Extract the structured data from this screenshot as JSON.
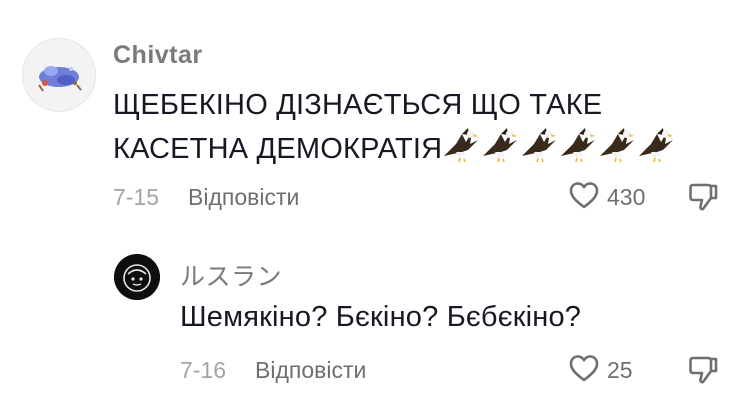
{
  "comments": [
    {
      "username": "Chivtar",
      "text": "ЩЕБЕКІНО ДІЗНАЄТЬСЯ ЩО ТАКЕ",
      "text_line2": "КАСЕТНА ДЕМОКРАТІЯ",
      "emoji": [
        "eagle-emoji",
        "eagle-emoji",
        "eagle-emoji",
        "eagle-emoji",
        "eagle-emoji",
        "eagle-emoji"
      ],
      "date": "7-15",
      "reply_label": "Відповісти",
      "likes": "430"
    },
    {
      "username": "ルスラン",
      "text": "Шемякіно? Бєкіно? Бєбєкіно?",
      "date": "7-16",
      "reply_label": "Відповісти",
      "likes": "25"
    }
  ],
  "icons": {
    "like": "heart-outline-icon",
    "dislike": "thumbs-down-outline-icon"
  },
  "colors": {
    "text": "#161823",
    "muted": "#a3a3a3",
    "secondary": "#6f6f6f"
  }
}
